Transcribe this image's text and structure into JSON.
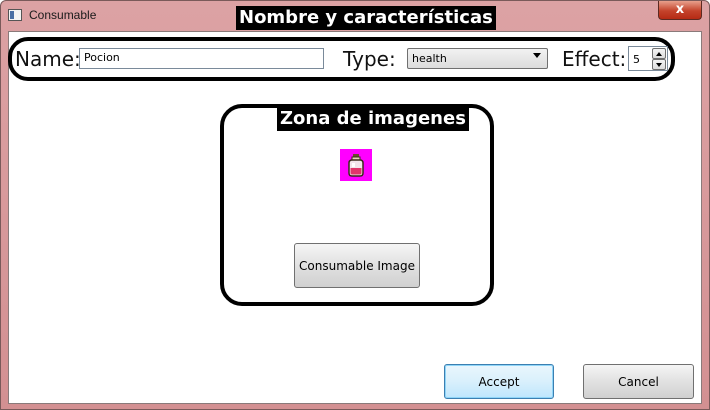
{
  "window": {
    "title": "Consumable",
    "close_label": "x"
  },
  "characteristics": {
    "title": "Nombre y características",
    "name_label": "Name:",
    "name_value": "Pocion",
    "type_label": "Type:",
    "type_value": "health",
    "effect_label": "Effect:",
    "effect_value": "5"
  },
  "images": {
    "title": "Zona de imagenes",
    "image_icon": "potion-icon",
    "image_button_label": "Consumable Image"
  },
  "footer": {
    "accept_label": "Accept",
    "cancel_label": "Cancel"
  },
  "colors": {
    "titlebar": "#d39092",
    "close_button": "#c4432b",
    "potion_background": "#ff00ff",
    "default_button_border": "#3c7fb1"
  }
}
